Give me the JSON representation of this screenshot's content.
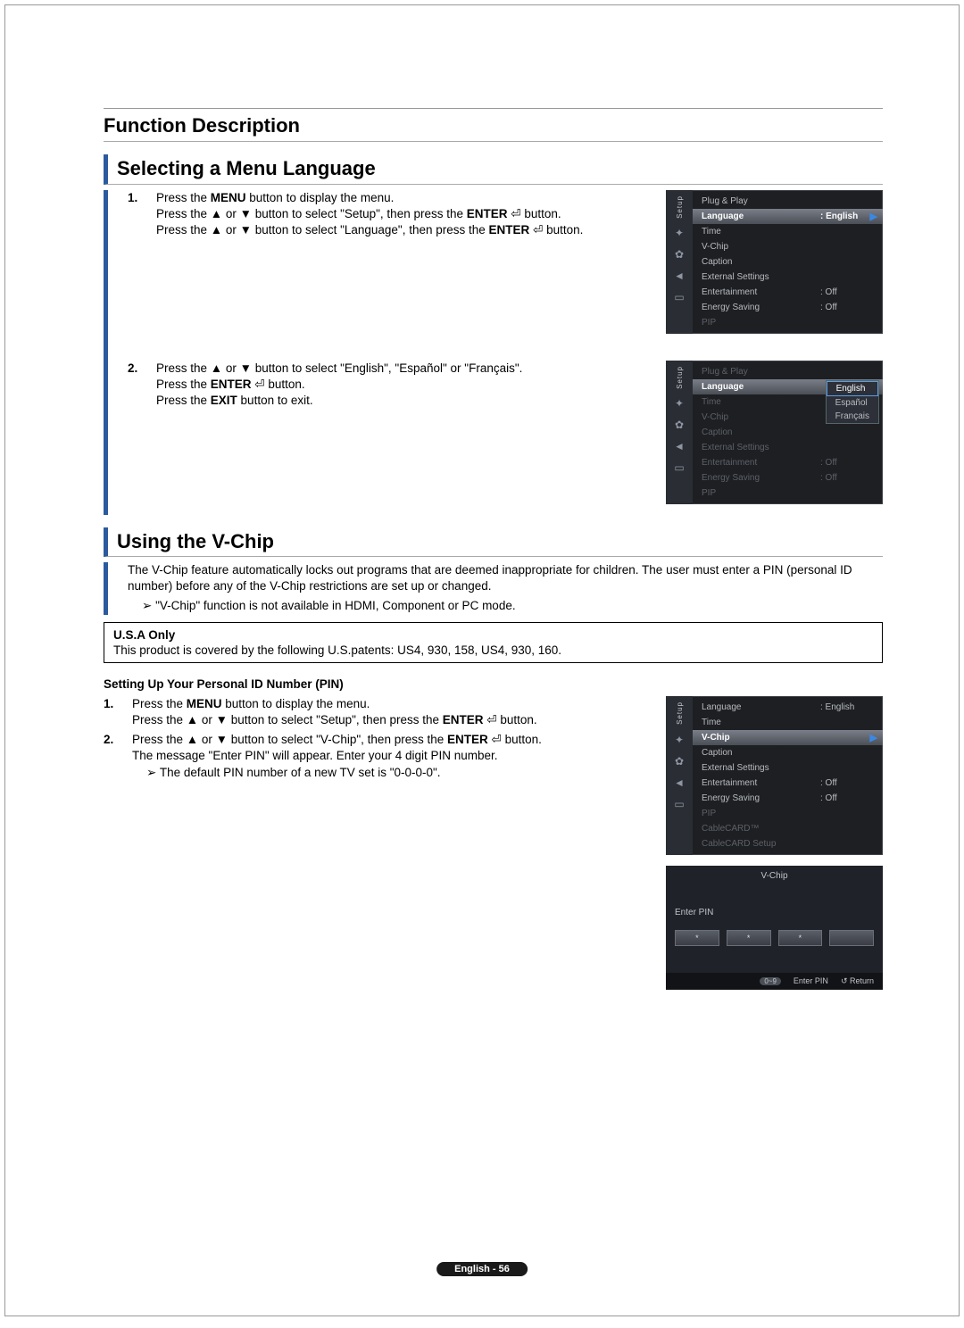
{
  "header": {
    "function_title": "Function Description"
  },
  "section1": {
    "title": "Selecting a Menu Language",
    "steps": [
      {
        "num": "1.",
        "lines": [
          "Press the MENU button to display the menu.",
          "Press the ▲ or ▼ button to select \"Setup\", then press the ENTER ⏎ button.",
          "Press the ▲ or ▼ button to select \"Language\", then press the ENTER ⏎ button."
        ]
      },
      {
        "num": "2.",
        "lines": [
          "Press the ▲ or ▼ button to select \"English\", \"Español\" or \"Français\".",
          "Press the ENTER ⏎ button.",
          "Press the EXIT button to exit."
        ]
      }
    ]
  },
  "osd1": {
    "tab": "Setup",
    "items": [
      {
        "label": "Plug & Play",
        "value": ""
      },
      {
        "label": "Language",
        "value": ": English",
        "selected": true
      },
      {
        "label": "Time",
        "value": ""
      },
      {
        "label": "V-Chip",
        "value": ""
      },
      {
        "label": "Caption",
        "value": ""
      },
      {
        "label": "External Settings",
        "value": ""
      },
      {
        "label": "Entertainment",
        "value": ": Off"
      },
      {
        "label": "Energy Saving",
        "value": ": Off"
      },
      {
        "label": "PIP",
        "value": "",
        "dim": true
      }
    ]
  },
  "osd2": {
    "tab": "Setup",
    "items": [
      {
        "label": "Plug & Play",
        "value": "",
        "dim": true
      },
      {
        "label": "Language",
        "value": "",
        "selected": true
      },
      {
        "label": "Time",
        "value": "",
        "dim": true
      },
      {
        "label": "V-Chip",
        "value": "",
        "dim": true
      },
      {
        "label": "Caption",
        "value": "",
        "dim": true
      },
      {
        "label": "External Settings",
        "value": "",
        "dim": true
      },
      {
        "label": "Entertainment",
        "value": ": Off",
        "dim": true
      },
      {
        "label": "Energy Saving",
        "value": ": Off",
        "dim": true
      },
      {
        "label": "PIP",
        "value": "",
        "dim": true
      }
    ],
    "dropdown": [
      "English",
      "Español",
      "Français"
    ],
    "dropdown_selected": 0
  },
  "section2": {
    "title": "Using the V-Chip",
    "intro": "The V-Chip feature automatically locks out programs that are deemed inappropriate for children. The user must enter a PIN (personal ID number) before any of the V-Chip restrictions are set up or changed.",
    "note": "\"V-Chip\" function is not available in HDMI, Component or PC mode.",
    "usa_box": {
      "title": "U.S.A Only",
      "body": "This product is covered by the following U.S.patents: US4, 930, 158, US4, 930, 160."
    },
    "sub_title": "Setting Up Your Personal ID Number (PIN)",
    "steps": [
      {
        "num": "1.",
        "lines": [
          "Press the MENU button to display the menu.",
          "Press the ▲ or ▼ button to select \"Setup\", then press the ENTER ⏎ button."
        ]
      },
      {
        "num": "2.",
        "lines": [
          "Press the ▲ or ▼ button to select \"V-Chip\", then press the ENTER ⏎ button.",
          "The message \"Enter PIN\" will appear. Enter your 4 digit PIN number."
        ],
        "note": "The default PIN number of a new TV set is \"0-0-0-0\"."
      }
    ]
  },
  "osd3": {
    "tab": "Setup",
    "items": [
      {
        "label": "Language",
        "value": ": English"
      },
      {
        "label": "Time",
        "value": ""
      },
      {
        "label": "V-Chip",
        "value": "",
        "selected": true
      },
      {
        "label": "Caption",
        "value": ""
      },
      {
        "label": "External Settings",
        "value": ""
      },
      {
        "label": "Entertainment",
        "value": ": Off"
      },
      {
        "label": "Energy Saving",
        "value": ": Off"
      },
      {
        "label": "PIP",
        "value": "",
        "dim": true
      },
      {
        "label": "CableCARD™",
        "value": "",
        "dim": true
      },
      {
        "label": "CableCARD Setup",
        "value": "",
        "dim": true
      }
    ]
  },
  "pin_panel": {
    "title": "V-Chip",
    "enter_label": "Enter PIN",
    "stars": [
      "*",
      "*",
      "*",
      ""
    ],
    "footer_lbl": "Enter PIN",
    "footer_pill": "0~9",
    "footer_return": "Return"
  },
  "footer": {
    "text": "English - 56"
  },
  "icons": {
    "wand": "✦",
    "gear": "✿",
    "signal": "◄",
    "screen": "▭"
  }
}
